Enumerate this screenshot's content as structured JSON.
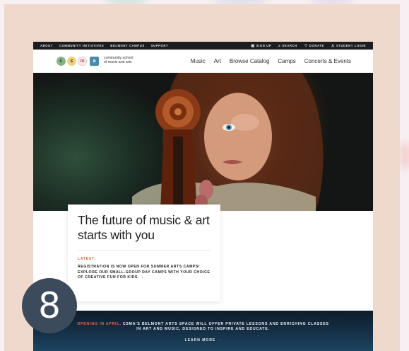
{
  "topbar": {
    "left_items": [
      "ABOUT",
      "COMMUNITY INITIATIVES",
      "BELMONT CAMPUS",
      "SUPPORT"
    ],
    "right_items": [
      {
        "icon": "calendar-icon",
        "label": "SIGN UP"
      },
      {
        "icon": "search-icon",
        "label": "SEARCH"
      },
      {
        "icon": "heart-icon",
        "label": "DONATE"
      },
      {
        "icon": "user-icon",
        "label": "STUDENT LOGIN"
      }
    ]
  },
  "logo": {
    "letters": [
      "c",
      "s",
      "m",
      "a"
    ],
    "line1": "community school",
    "line2": "of music and arts"
  },
  "nav": {
    "items": [
      "Music",
      "Art",
      "Browse Catalog",
      "Camps",
      "Concerts & Events"
    ]
  },
  "card": {
    "headline": "The future of music & art starts with you",
    "latest_label": "LATEST:",
    "news": "REGISTRATION IS NOW OPEN FOR SUMMER ARTS CAMPS! EXPLORE OUR SMALL-GROUP DAY CAMPS WITH YOUR CHOICE OF CREATIVE FUN FOR KIDS.",
    "news_arrow": "›"
  },
  "banner": {
    "accent": "OPENING IN APRIL,",
    "message": "CSMA'S BELMONT ARTS SPACE WILL OFFER PRIVATE LESSONS AND ENRICHING CLASSES IN ART AND MUSIC, DESIGNED TO INSPIRE AND EDUCATE.",
    "cta": "LEARN MORE",
    "cta_arrow": "›"
  },
  "badge_number": "8",
  "colors": {
    "accent": "#d3643e",
    "topbar": "#1d1d1f",
    "frame": "#efd9cc",
    "badge": "#3b4b5c"
  }
}
